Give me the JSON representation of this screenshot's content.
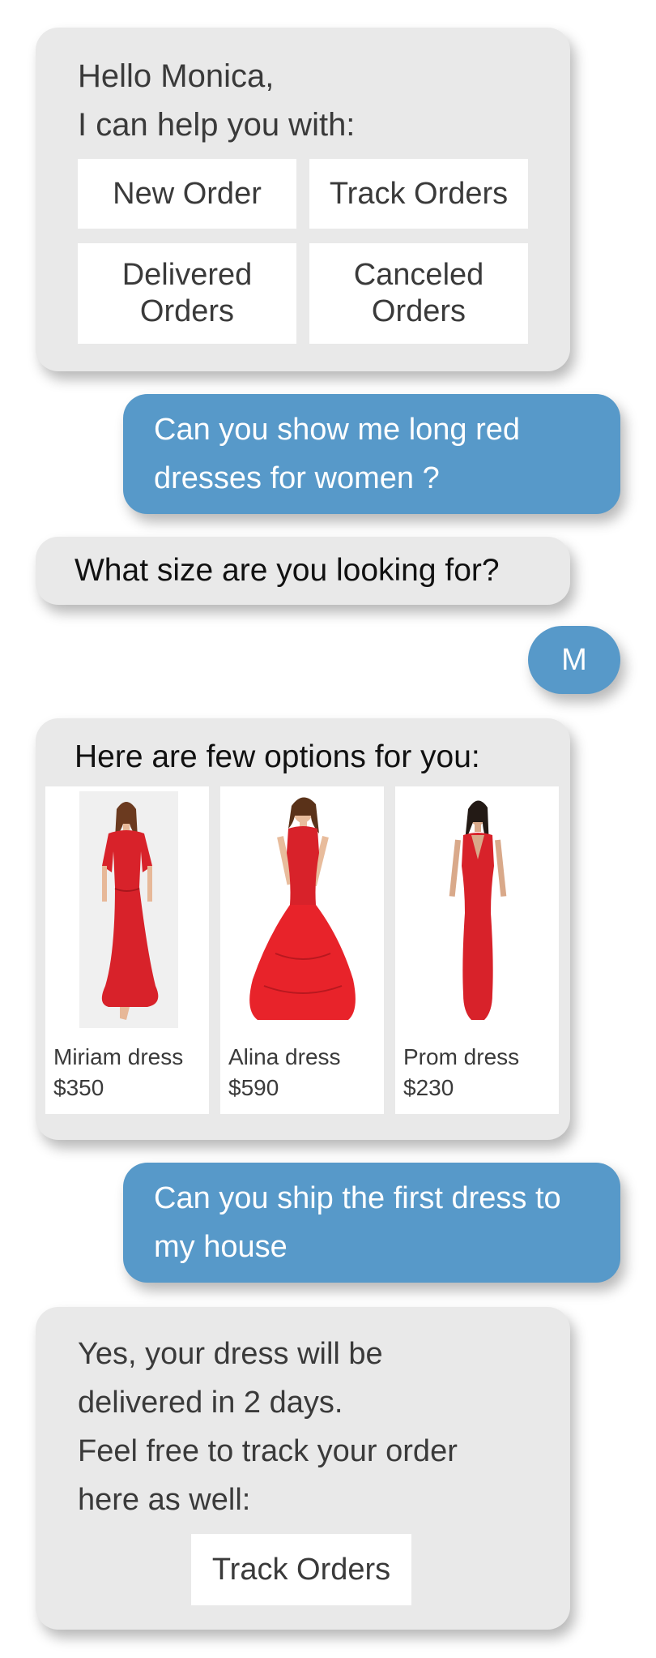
{
  "greeting": {
    "line1": "Hello Monica,",
    "line2": "I can help you with:",
    "options": {
      "new_order": "New Order",
      "track_orders": "Track Orders",
      "delivered_line1": "Delivered",
      "delivered_line2": "Orders",
      "canceled_line1": "Canceled",
      "canceled_line2": "Orders"
    }
  },
  "user_message_1": {
    "line1": "Can you show me long red",
    "line2": "dresses for women ?"
  },
  "size_question": "What size are you looking for?",
  "user_size_reply": "M",
  "products": {
    "title": "Here are few options for you:",
    "items": [
      {
        "name": "Miriam dress",
        "price": "$350"
      },
      {
        "name": "Alina dress",
        "price": "$590"
      },
      {
        "name": "Prom dress",
        "price": "$230"
      }
    ]
  },
  "user_message_2": {
    "line1": "Can you ship the first dress to",
    "line2": "my house"
  },
  "confirmation": {
    "line1": "Yes, your dress will be",
    "line2": "delivered in 2 days.",
    "line3": "Feel free to track your order",
    "line4": "here as well:",
    "track_button": "Track Orders"
  },
  "colors": {
    "bot_bubble": "#e9e9e9",
    "user_bubble": "#5799c9",
    "dress_red": "#d8222a"
  }
}
